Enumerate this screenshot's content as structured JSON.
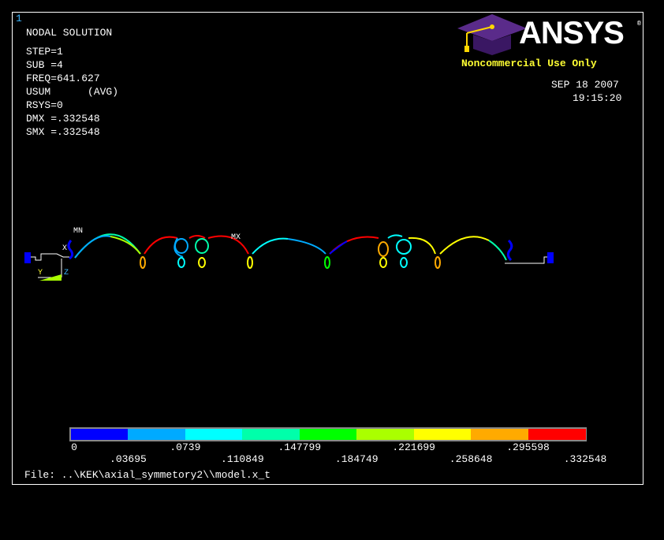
{
  "window_number": "1",
  "header": {
    "title": "NODAL SOLUTION",
    "lines": [
      "STEP=1",
      "SUB =4",
      "FREQ=641.627",
      "USUM      (AVG)",
      "RSYS=0",
      "DMX =.332548",
      "SMX =.332548"
    ]
  },
  "logo": {
    "brand": "ANSYS",
    "registered": "®",
    "license_note": "Noncommercial Use Only"
  },
  "date": "SEP 18 2007",
  "time": "19:15:20",
  "labels": {
    "min": "MN",
    "max": "MX",
    "axis_x": "X",
    "axis_y": "Y",
    "axis_z": "Z"
  },
  "legend": {
    "colors": [
      "#0000ff",
      "#00aaff",
      "#00ffff",
      "#00ffaa",
      "#00ff00",
      "#aaff00",
      "#ffff00",
      "#ffaa00",
      "#ff0000"
    ],
    "values_row1": [
      "0",
      ".0739",
      ".147799",
      ".221699",
      ".295598"
    ],
    "values_row2": [
      ".03695",
      ".110849",
      ".184749",
      ".258648",
      ".332548"
    ]
  },
  "footer": {
    "file": "File: ..\\KEK\\axial_symmetory2\\\\model.x_t"
  }
}
